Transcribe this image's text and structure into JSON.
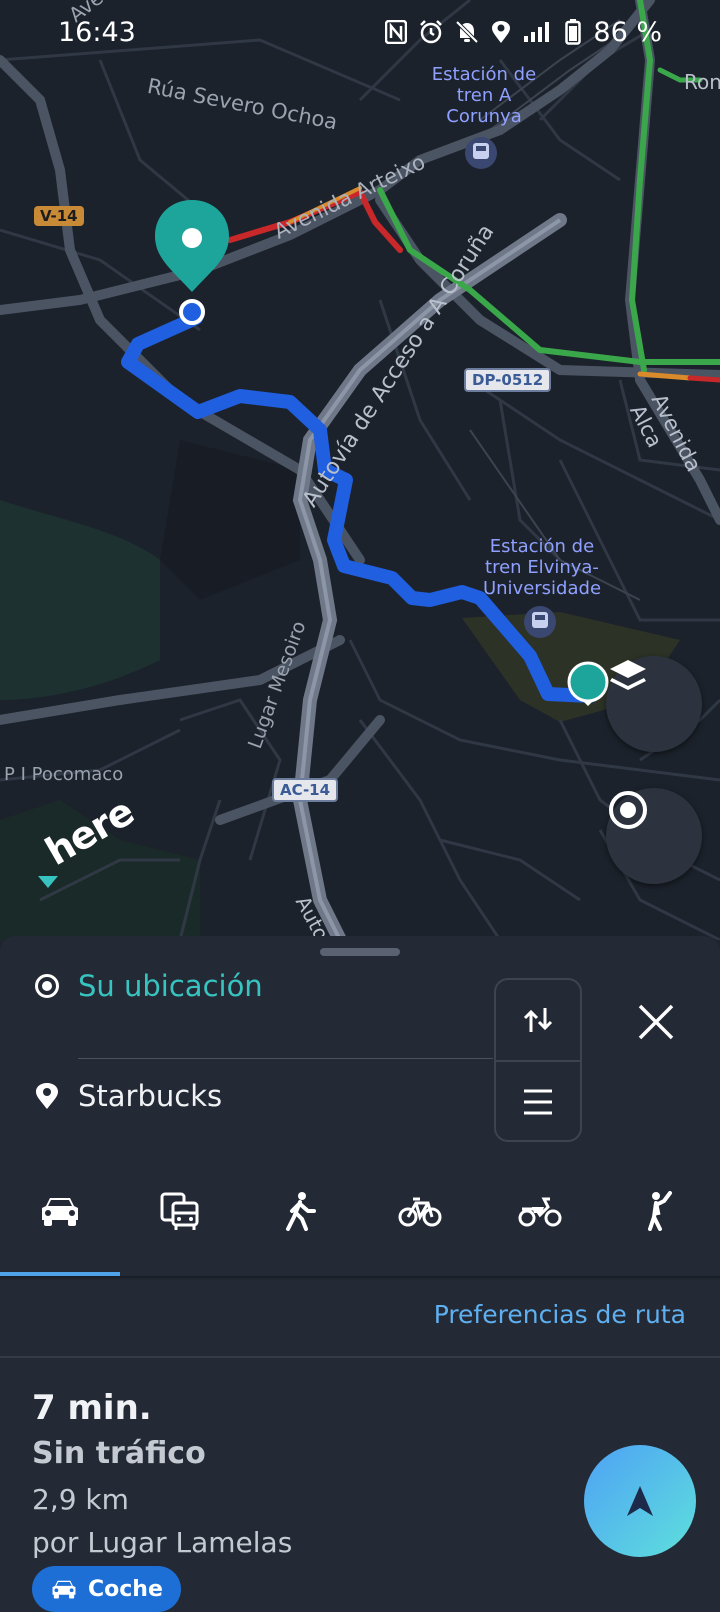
{
  "status_bar": {
    "time": "16:43",
    "battery": "86 %",
    "icons": [
      "nfc-icon",
      "alarm-icon",
      "mute-icon",
      "location-icon",
      "signal-icon",
      "battery-icon"
    ]
  },
  "map": {
    "labels": {
      "avenida_top": "Avenida d",
      "rua_severo": "Rúa Severo Ochoa",
      "avenida_arteixo": "Avenida Arteixo",
      "autovia": "Autovía de Acceso a A Coruña",
      "lugar_mesoiro": "Lugar Mesoiro",
      "pi_pocomaco": "P I Pocomaco",
      "avenida_alca": "Avenida Alca",
      "ron": "Ron",
      "auto_bottom": "Auto",
      "station1_l1": "Estación de",
      "station1_l2": "tren A",
      "station1_l3": "Corunya",
      "station2_l1": "Estación de",
      "station2_l2": "tren Elvinya-",
      "station2_l3": "Universidade"
    },
    "badges": {
      "v14": "V-14",
      "dp0512": "DP-0512",
      "ac14": "AC-14"
    },
    "logo": "here",
    "colors": {
      "route": "#1f5fe0",
      "destination_pin": "#1ea59b",
      "traffic_green": "#3aa84a",
      "traffic_red": "#c8282a",
      "traffic_orange": "#d98a2a"
    }
  },
  "sheet": {
    "origin": "Su ubicación",
    "destination": "Starbucks",
    "origin_color": "#37c4c0",
    "modes": [
      "car-icon",
      "transit-icon",
      "walk-icon",
      "bicycle-icon",
      "motorcycle-icon",
      "taxi-icon"
    ],
    "preferences_link": "Preferencias de ruta",
    "route": {
      "time": "7 min.",
      "traffic": "Sin tráfico",
      "distance": "2,9 km",
      "via": "por Lugar Lamelas",
      "mode_chip": "Coche"
    }
  }
}
